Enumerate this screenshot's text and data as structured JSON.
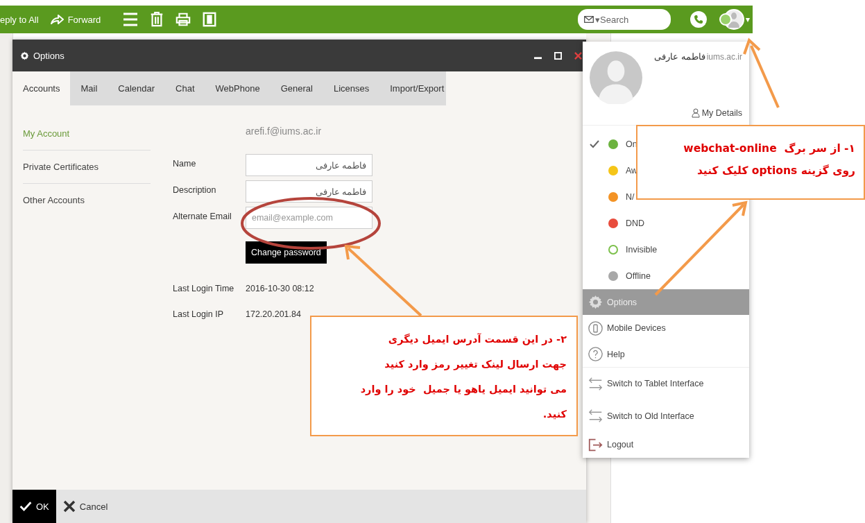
{
  "toolbar": {
    "actions": [
      {
        "kind": "reply-all",
        "label": "eply to All"
      },
      {
        "kind": "forward",
        "label": "Forward"
      }
    ],
    "icons": [
      {
        "kind": "menu"
      },
      {
        "kind": "trash"
      },
      {
        "kind": "print"
      },
      {
        "kind": "panel"
      }
    ],
    "search": {
      "placeholder": "▾Search"
    },
    "caret": "▾"
  },
  "dialog": {
    "title": "Options",
    "tabs": [
      {
        "label": "Accounts",
        "selected": true
      },
      {
        "label": "Mail",
        "selected": false
      },
      {
        "label": "Calendar",
        "selected": false
      },
      {
        "label": "Chat",
        "selected": false
      },
      {
        "label": "WebPhone",
        "selected": false
      },
      {
        "label": "General",
        "selected": false
      },
      {
        "label": "Licenses",
        "selected": false
      },
      {
        "label": "Import/Export",
        "selected": false
      }
    ],
    "sidebar": [
      {
        "label": "My Account",
        "selected": true
      },
      {
        "label": "Private Certificates",
        "selected": false
      },
      {
        "label": "Other Accounts",
        "selected": false
      }
    ],
    "account": "arefi.f@iums.ac.ir",
    "fields": [
      {
        "label": "Name",
        "value": "فاطمه عارفی"
      },
      {
        "label": "Description",
        "value": "فاطمه عارفی"
      },
      {
        "label": "Alternate Email",
        "placeholder": "email@example.com"
      }
    ],
    "change_password": "Change password",
    "info": [
      {
        "label": "Last Login Time",
        "value": "2016-10-30 08:12"
      },
      {
        "label": "Last Login IP",
        "value": "172.20.201.84"
      }
    ],
    "footer": [
      {
        "kind": "ok",
        "label": "OK"
      },
      {
        "kind": "cancel",
        "label": "Cancel"
      }
    ]
  },
  "profile_menu": {
    "name": "فاطمه عارفی",
    "domain": "iums.ac.ir",
    "details": "My Details",
    "statuses": [
      {
        "label": "On",
        "color": "#6cb33f",
        "kind": "dot",
        "selected": true
      },
      {
        "label": "Aw",
        "color": "#f5c518",
        "kind": "dot",
        "selected": false
      },
      {
        "label": "N/",
        "color": "#f39325",
        "kind": "dot",
        "selected": false
      },
      {
        "label": "DND",
        "color": "#e84c3d",
        "kind": "dot",
        "selected": false
      },
      {
        "label": "Invisible",
        "color": "#7cc04b",
        "kind": "ring",
        "selected": false
      },
      {
        "label": "Offline",
        "color": "#a8a8a8",
        "kind": "dot",
        "selected": false
      }
    ],
    "items": [
      {
        "kind": "options",
        "label": "Options",
        "selected": true
      },
      {
        "kind": "mobile",
        "label": "Mobile Devices",
        "selected": false
      },
      {
        "kind": "help",
        "label": "Help",
        "selected": false
      },
      {
        "kind": "switch",
        "label": "Switch to Tablet Interface",
        "selected": false
      },
      {
        "kind": "switch",
        "label": "Switch to Old Interface",
        "selected": false
      },
      {
        "kind": "logout",
        "label": "Logout",
        "selected": false
      }
    ]
  },
  "callouts": [
    {
      "lines": [
        "۱- از سر برگ  webchat-online",
        "روی گزینه options کلیک کنید"
      ]
    },
    {
      "lines": [
        "۲- در این قسمت آدرس ایمیل دیگری",
        "جهت ارسال لینک تغییر رمز وارد کنید",
        "می توانید ایمیل یاهو یا جمیل  خود را وارد",
        "کنید."
      ]
    }
  ]
}
